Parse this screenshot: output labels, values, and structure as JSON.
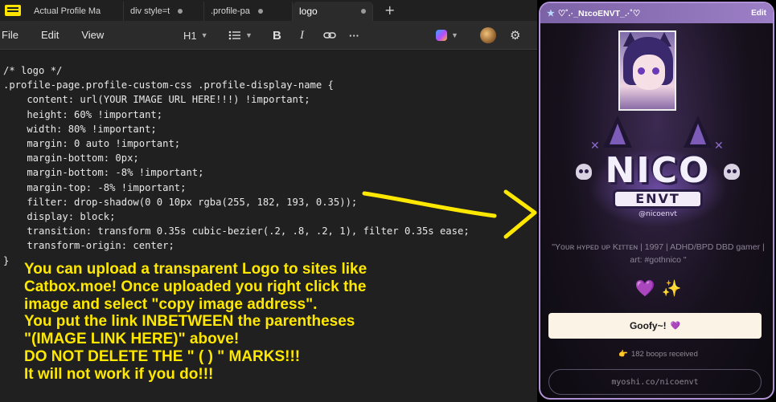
{
  "tabs": [
    {
      "label": "Actual Profile Ma",
      "active": false
    },
    {
      "label": "div style=t",
      "active": false
    },
    {
      "label": ".profile-pa",
      "active": false
    },
    {
      "label": "logo",
      "active": true
    }
  ],
  "menu": [
    "File",
    "Edit",
    "View"
  ],
  "toolbar": {
    "heading_style": "H1",
    "bold_label": "B",
    "italic_label": "I",
    "more_label": "···"
  },
  "code_lines": [
    "/* logo */",
    ".profile-page.profile-custom-css .profile-display-name {",
    "    content: url(YOUR IMAGE URL HERE!!!) !important;",
    "    height: 60% !important;",
    "    width: 80% !important;",
    "    margin: 0 auto !important;",
    "    margin-bottom: 0px;",
    "    margin-bottom: -8% !important;",
    "    margin-top: -8% !important;",
    "    filter: drop-shadow(0 0 10px rgba(255, 182, 193, 0.35));",
    "    display: block;",
    "    transition: transform 0.35s cubic-bezier(.2, .8, .2, 1), filter 0.35s ease;",
    "    transform-origin: center;",
    "}"
  ],
  "note_lines": [
    "You can upload a transparent Logo to sites like",
    "Catbox.moe! Once uploaded you right click the",
    "image and select \"copy image address\".",
    "You put the link INBETWEEN the parentheses",
    "\"(IMAGE LINK HERE)\" above!",
    "DO NOT DELETE THE \" ( ) \" MARKS!!!",
    "It will not work if you do!!!"
  ],
  "profile": {
    "header_title": "♡˚.·_NɪcoENVT_.·˚♡",
    "edit_label": "Edit",
    "logo_main": "NICO",
    "logo_sub": "ENVT",
    "logo_handle": "@nicoenvt",
    "bio": "\"Yᴏᴜʀ ʜʏᴘᴇᴅ ᴜᴘ Kɪᴛᴛᴇɴ | 1997 | ADHD/BPD DBD gamer | art: #gothnico \"",
    "heart_emoji": "💜",
    "sparkle_emoji": "✨",
    "button_label": "Goofy~!",
    "button_heart": "💜",
    "boops_text": "182 boops received",
    "hand_emoji": "👉",
    "link": "myoshi.co/nicoenvt"
  },
  "colors": {
    "note_yellow": "#ffe800",
    "panel_border": "#b292d6",
    "accent_purple": "#8a4fe0"
  }
}
